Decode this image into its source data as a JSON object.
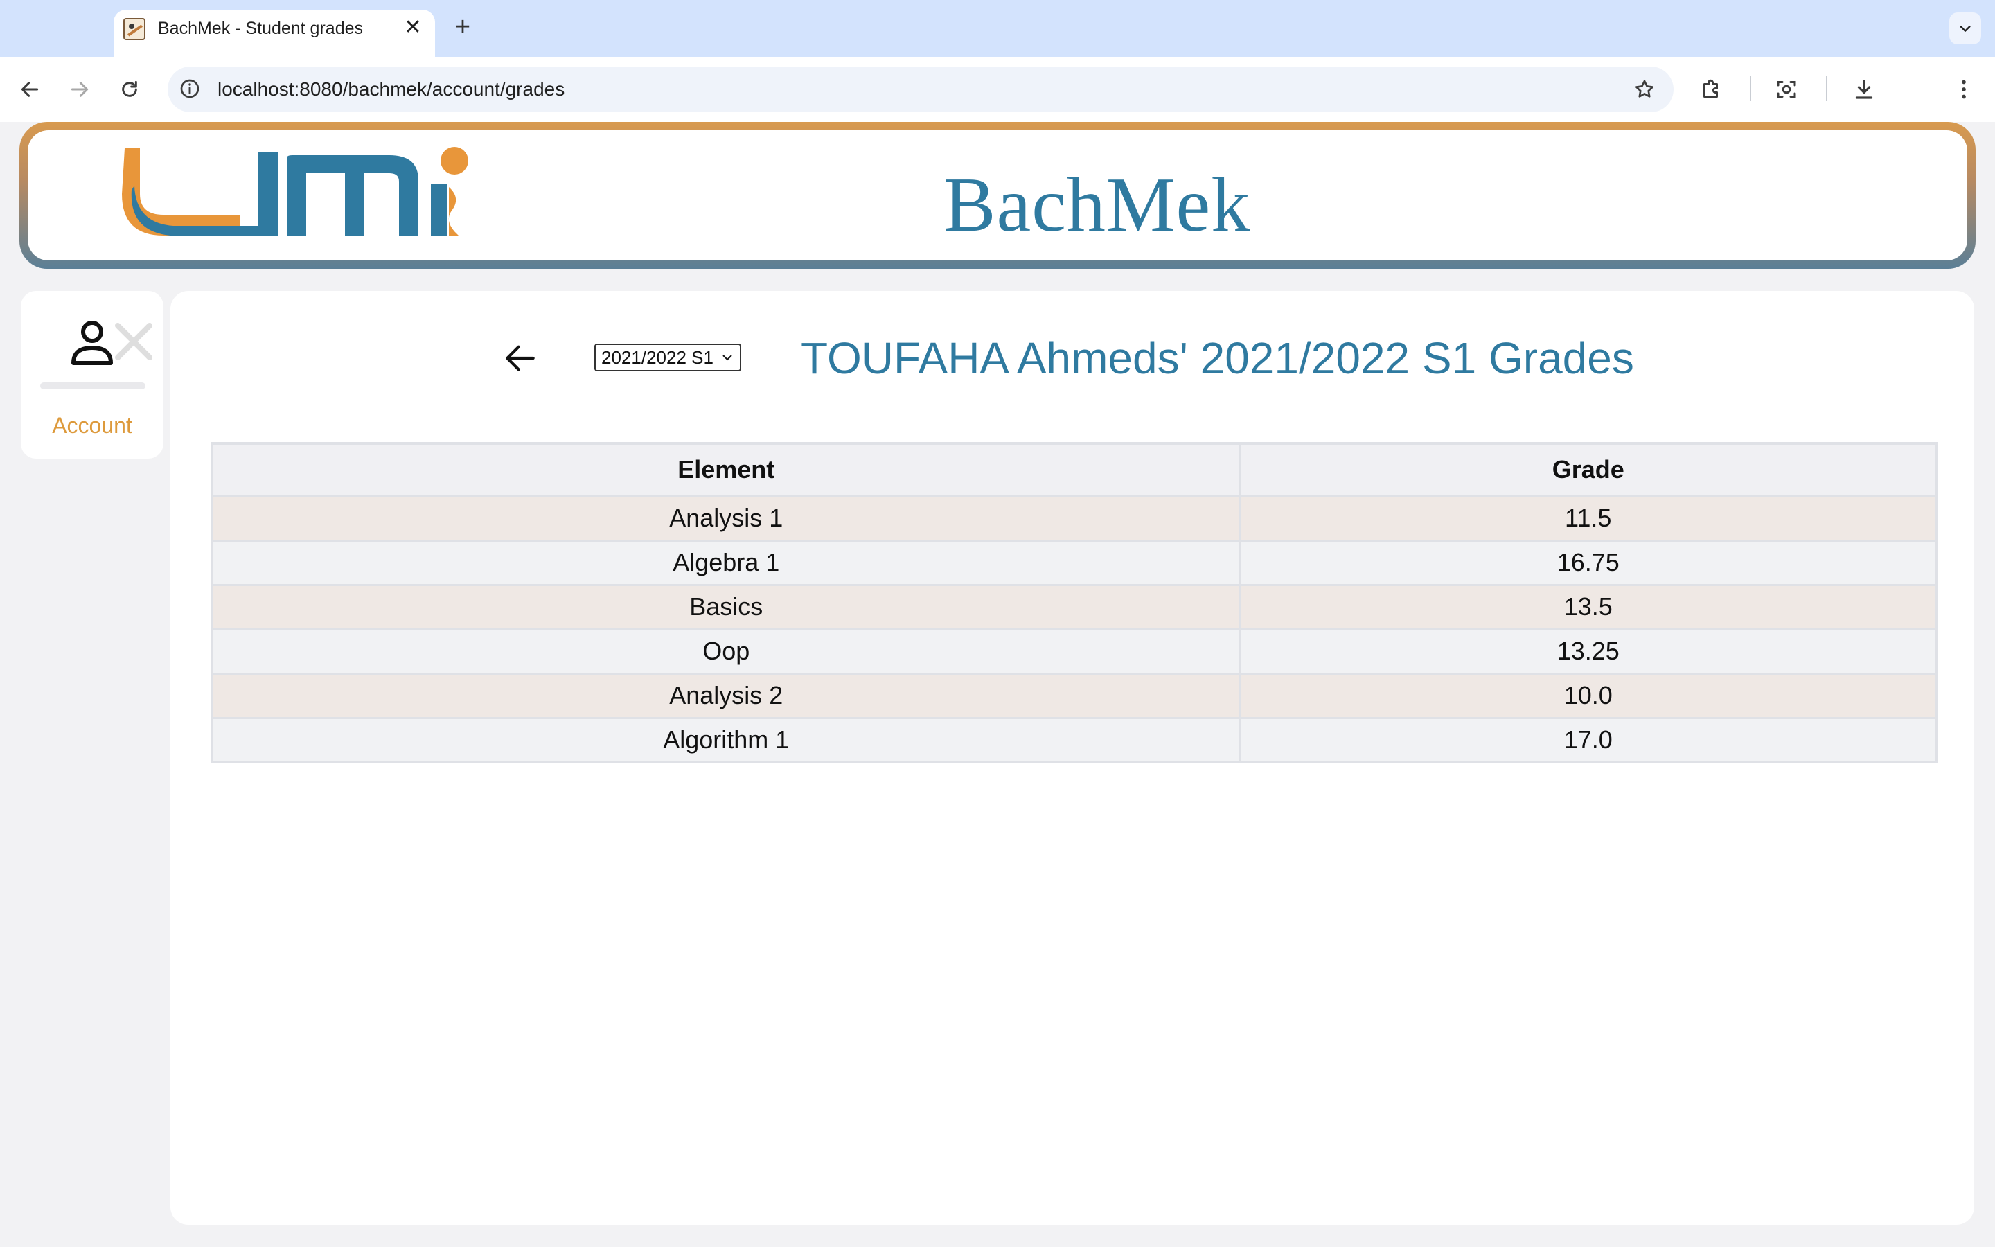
{
  "browser": {
    "tab_title": "BachMek - Student grades",
    "url": "localhost:8080/bachmek/account/grades"
  },
  "header": {
    "app_name": "BachMek",
    "logo_text": "umi",
    "colors": {
      "blue": "#2f7aa0",
      "orange": "#e8963a"
    }
  },
  "sidebar": {
    "account_label": "Account"
  },
  "main": {
    "semester_selected": "2021/2022 S1",
    "title": "TOUFAHA Ahmeds' 2021/2022 S1 Grades",
    "table": {
      "headers": [
        "Element",
        "Grade"
      ],
      "rows": [
        {
          "element": "Analysis 1",
          "grade": "11.5"
        },
        {
          "element": "Algebra 1",
          "grade": "16.75"
        },
        {
          "element": "Basics",
          "grade": "13.5"
        },
        {
          "element": "Oop",
          "grade": "13.25"
        },
        {
          "element": "Analysis 2",
          "grade": "10.0"
        },
        {
          "element": "Algorithm 1",
          "grade": "17.0"
        }
      ]
    }
  }
}
